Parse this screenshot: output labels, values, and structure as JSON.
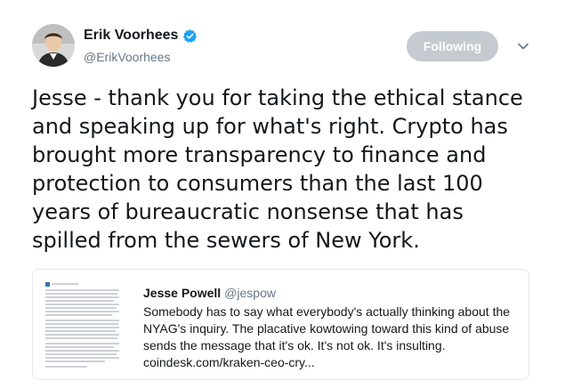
{
  "author": {
    "display_name": "Erik Voorhees",
    "handle": "@ErikVoorhees",
    "verified": true
  },
  "actions": {
    "follow_label": "Following"
  },
  "tweet": {
    "text": "Jesse - thank you for taking the ethical stance and speaking up for what's right. Crypto has brought more transparency to finance and protection to consumers than the last 100 years of bureaucratic nonsense that has spilled from the sewers of New York."
  },
  "quoted_tweet": {
    "display_name": "Jesse Powell",
    "handle": "@jespow",
    "text": "Somebody has to say what everybody's actually thinking about the NYAG's inquiry. The placative kowtowing toward this kind of abuse sends the message that it's ok. It's not ok. It's insulting.",
    "link": "coindesk.com/kraken-ceo-cry..."
  },
  "colors": {
    "verified_badge": "#1da1f2",
    "following_button_bg": "#c4cacf",
    "secondary_text": "#657786",
    "border": "#e1e8ed"
  },
  "icons": {
    "verified": "verified-badge-icon",
    "caret": "chevron-down-icon",
    "avatar": "profile-photo"
  }
}
